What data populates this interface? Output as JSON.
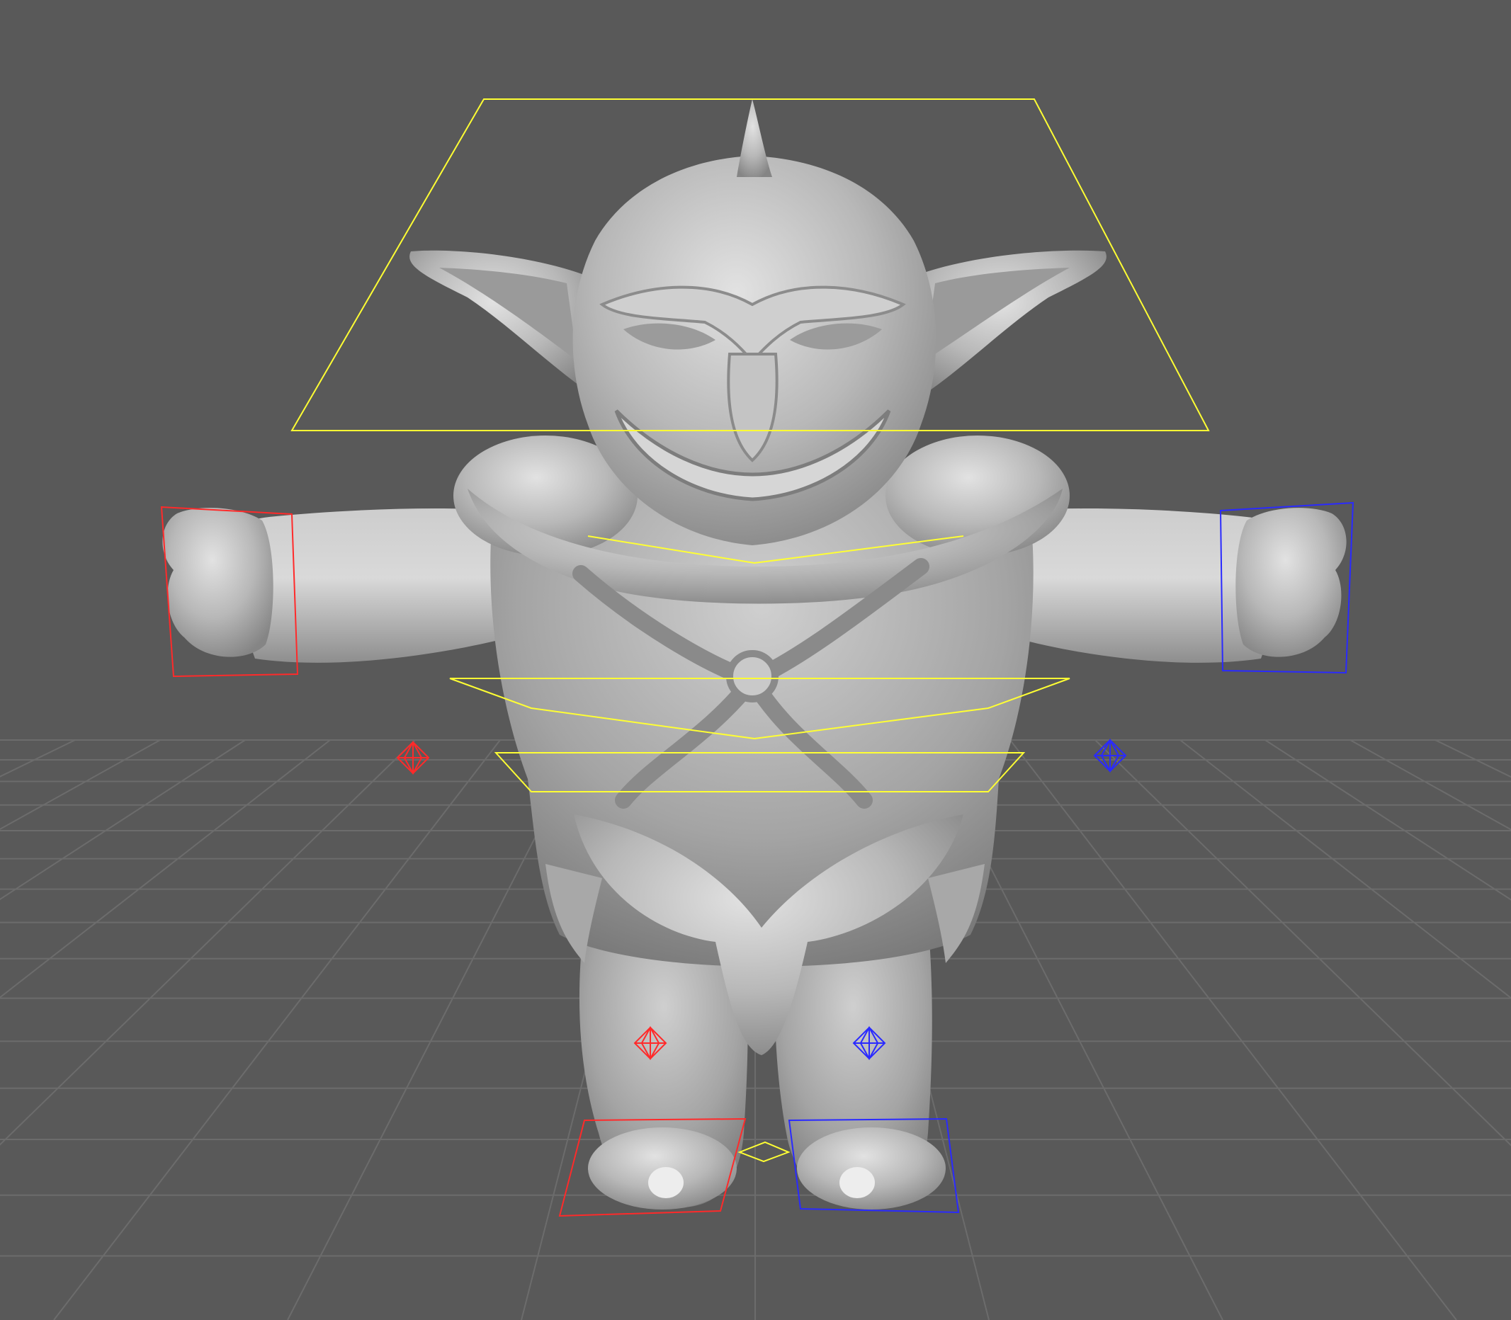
{
  "viewport": {
    "background_color": "#595959",
    "grid_color": "#6c6c6c",
    "model_color": "#b9b9b9",
    "model_highlight_color": "#e4e4e4",
    "model_shadow_color": "#7e7e7e"
  },
  "rig": {
    "center_color": "#ffff33",
    "left_side_color": "#ff2a2a",
    "right_side_color": "#2a2aff"
  },
  "icons": {
    "model": "goblin-character-mesh",
    "controls": [
      "head-control",
      "chest-control",
      "hip-control",
      "hand-control",
      "foot-control",
      "pole-vector-locator",
      "root-control"
    ]
  }
}
